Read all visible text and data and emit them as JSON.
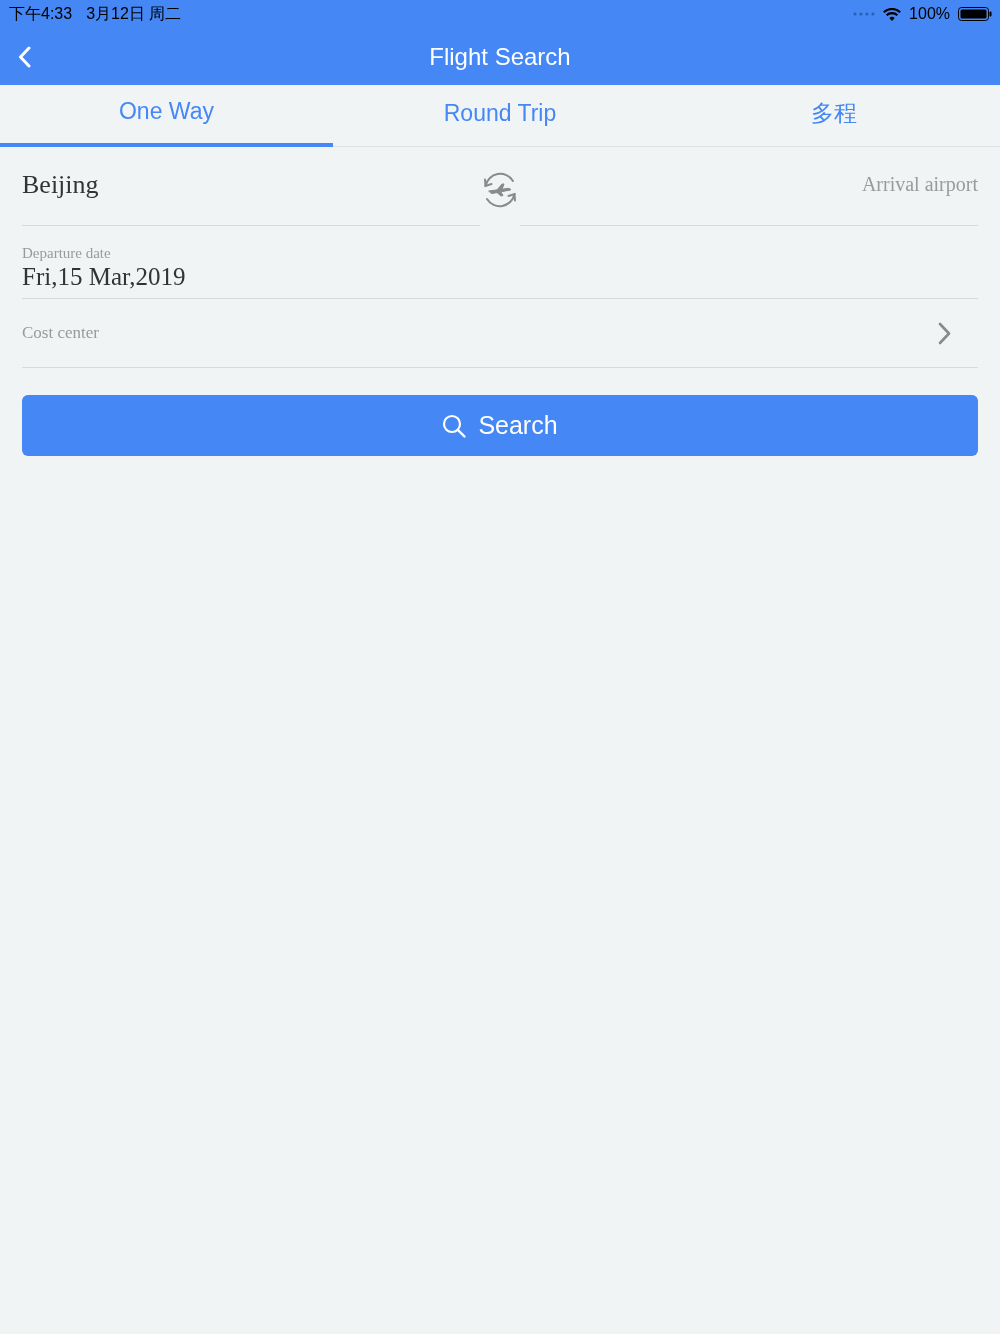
{
  "status_bar": {
    "time": "下午4:33",
    "date": "3月12日 周二",
    "battery": "100%"
  },
  "nav_bar": {
    "title": "Flight Search"
  },
  "tabs": [
    {
      "label": "One Way",
      "selected": true
    },
    {
      "label": "Round Trip",
      "selected": false
    },
    {
      "label": "多程",
      "selected": false
    }
  ],
  "route": {
    "departure": {
      "value": "Beijing"
    },
    "arrival": {
      "placeholder": "Arrival airport"
    }
  },
  "departure_date": {
    "label": "Departure date",
    "value": "Fri,15 Mar,2019"
  },
  "cost_center": {
    "label": "Cost center"
  },
  "search_button": {
    "label": "Search"
  }
}
